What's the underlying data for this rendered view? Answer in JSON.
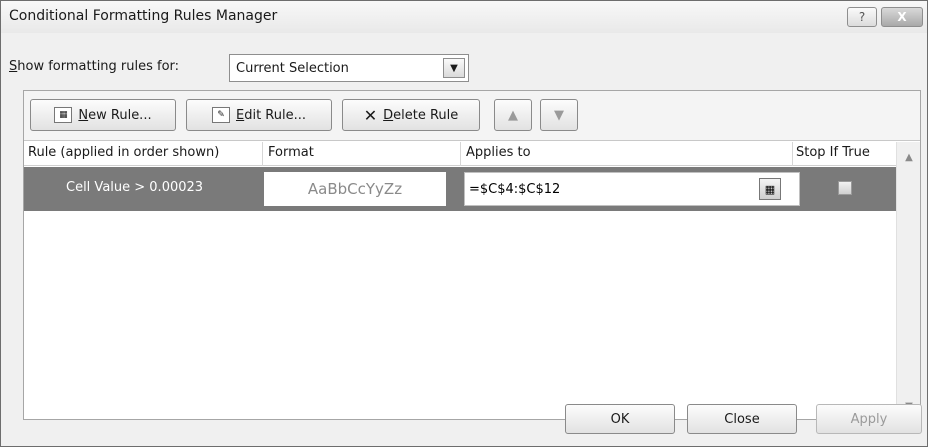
{
  "window": {
    "title": "Conditional Formatting Rules Manager",
    "help_glyph": "?",
    "close_glyph": "X"
  },
  "show_rules": {
    "label_underlined": "S",
    "label_rest": "how formatting rules for:",
    "selected": "Current Selection",
    "arrow": "▼"
  },
  "toolbar": {
    "new_rule": {
      "underlined": "N",
      "rest": "ew Rule..."
    },
    "edit_rule": {
      "underlined": "E",
      "rest": "dit Rule..."
    },
    "delete_rule": {
      "underlined": "D",
      "rest": "elete Rule"
    },
    "move_up_glyph": "▲",
    "move_down_glyph": "▼"
  },
  "table": {
    "columns": [
      "Rule (applied in order shown)",
      "Format",
      "Applies to",
      "Stop If True"
    ],
    "rows": [
      {
        "rule": "Cell Value > 0.00023",
        "format_preview": "AaBbCcYyZz",
        "applies_to": "=$C$4:$C$12",
        "stop_if_true": false
      }
    ]
  },
  "buttons": {
    "ok": "OK",
    "close": "Close",
    "apply": "Apply"
  }
}
